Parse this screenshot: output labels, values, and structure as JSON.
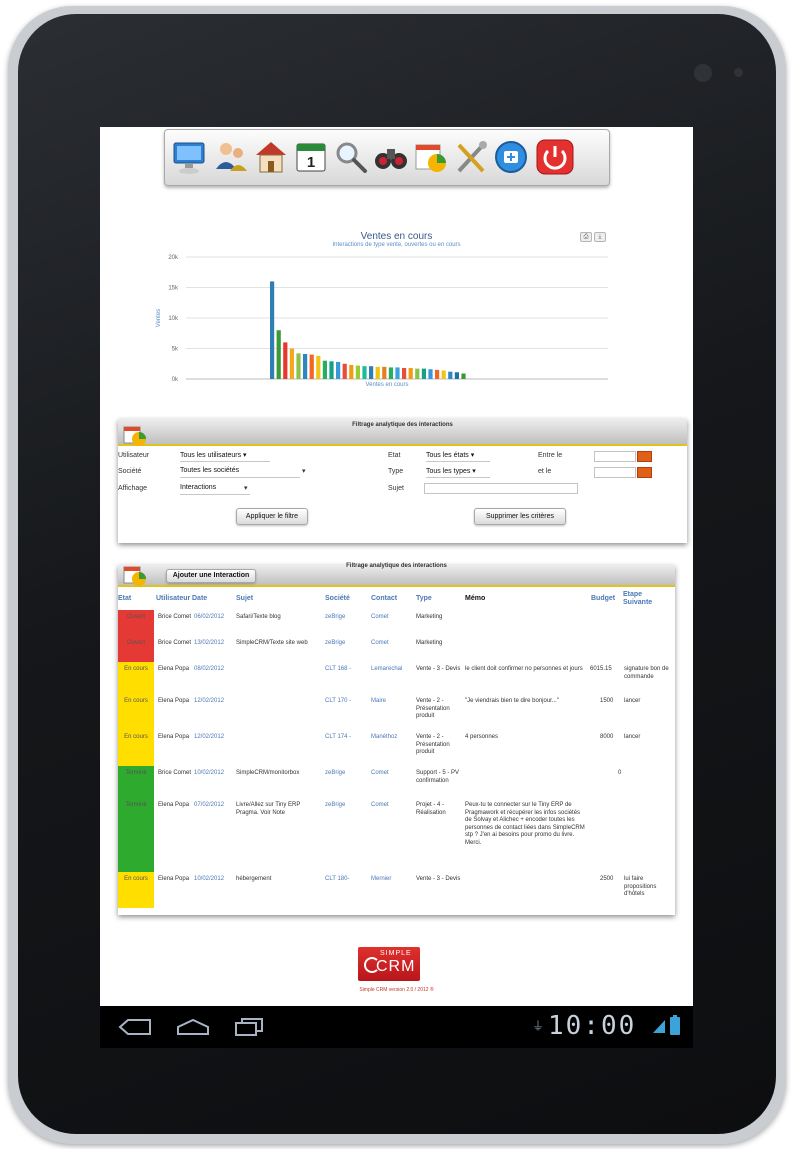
{
  "toolbar": {
    "icons": [
      "computer-icon",
      "users-icon",
      "home-icon",
      "calendar-icon",
      "search-icon",
      "binoculars-icon",
      "reports-icon",
      "tools-icon",
      "add-icon",
      "power-icon"
    ],
    "calendar_day": "1"
  },
  "chart_data": {
    "type": "bar",
    "title": "Ventes en cours",
    "subtitle": "Interactions de type vente, ouvertes ou en cours",
    "ylabel": "Ventes",
    "xlabel": "Ventes en cours",
    "y_ticks": [
      "20k",
      "15k",
      "10k",
      "5k",
      "0k"
    ],
    "ylim": [
      0,
      20000
    ],
    "values": [
      16000,
      8000,
      6000,
      5000,
      4200,
      4100,
      4000,
      3800,
      3000,
      2900,
      2800,
      2500,
      2300,
      2200,
      2100,
      2100,
      2000,
      2000,
      1900,
      1900,
      1800,
      1800,
      1700,
      1700,
      1600,
      1500,
      1400,
      1200,
      1100,
      900
    ],
    "colors": [
      "#2f7fb5",
      "#3a9a35",
      "#e8372c",
      "#f4a81d",
      "#8bc34a",
      "#2e86c1",
      "#f26522",
      "#f0c419",
      "#27ae60",
      "#16a085",
      "#3498db",
      "#e74c3c",
      "#f39c12",
      "#9acd32",
      "#1abc9c",
      "#2f7fb5",
      "#f1c40f",
      "#e67e22",
      "#27ae60",
      "#3aa3d8",
      "#e74c3c",
      "#f39c12",
      "#8bc34a",
      "#16a085",
      "#3498db",
      "#f26522",
      "#f0c419",
      "#2e86c1",
      "#1f6fa8",
      "#3a9a35"
    ],
    "grid": true,
    "legend": "none"
  },
  "filter": {
    "title": "Filtrage analytique des interactions",
    "utilisateur_label": "Utilisateur",
    "utilisateur_value": "Tous les utilisateurs ▾",
    "societe_label": "Société",
    "societe_value": "Toutes les sociétés",
    "affichage_label": "Affichage",
    "affichage_value": "Interactions",
    "etat_label": "Etat",
    "etat_value": "Tous les états ▾",
    "type_label": "Type",
    "type_value": "Tous les types ▾",
    "sujet_label": "Sujet",
    "entre_label": "Entre le",
    "et_label": "et le",
    "apply_button": "Appliquer le filtre",
    "clear_button": "Supprimer les critères"
  },
  "list": {
    "title": "Filtrage analytique des interactions",
    "add_button": "Ajouter une Interaction",
    "headers": {
      "etat": "Etat",
      "utilisateur": "Utilisateur",
      "date": "Date",
      "sujet": "Sujet",
      "societe": "Société",
      "contact": "Contact",
      "type": "Type",
      "memo": "Mémo",
      "budget": "Budget",
      "etape": "Etape Suivante"
    },
    "rows": [
      {
        "etat": "Ouvert",
        "color": "#e53935",
        "utilisateur": "Brice Comet",
        "date": "06/02/2012",
        "sujet": "Safari/Texte blog",
        "societe": "zeBrige",
        "contact": "Comet",
        "type": "Marketing",
        "memo": "",
        "budget": "",
        "etape": ""
      },
      {
        "etat": "Ouvert",
        "color": "#e53935",
        "utilisateur": "Brice Comet",
        "date": "13/02/2012",
        "sujet": "SimpleCRM/Texte site web",
        "societe": "zeBrige",
        "contact": "Comet",
        "type": "Marketing",
        "memo": "",
        "budget": "",
        "etape": ""
      },
      {
        "etat": "En cours",
        "color": "#ffde00",
        "utilisateur": "Elena Popa",
        "date": "08/02/2012",
        "sujet": "",
        "societe": "CLT 168 -",
        "contact": "Lemarechal",
        "type": "Vente - 3 - Devis",
        "memo": "le client doit confirmer no personnes et jours",
        "budget": "6015.15",
        "etape": "signature bon de commande"
      },
      {
        "etat": "En cours",
        "color": "#ffde00",
        "utilisateur": "Elena Popa",
        "date": "12/02/2012",
        "sujet": "",
        "societe": "CLT 170 -",
        "contact": "Maire",
        "type": "Vente - 2 - Présentation produit",
        "memo": "\"Je viendrais bien te dire bonjour...\"",
        "budget": "1500",
        "etape": "lancer"
      },
      {
        "etat": "En cours",
        "color": "#ffde00",
        "utilisateur": "Elena Popa",
        "date": "12/02/2012",
        "sujet": "",
        "societe": "CLT 174 -",
        "contact": "Manéthoz",
        "type": "Vente - 2 - Présentation produit",
        "memo": "4 personnes",
        "budget": "8000",
        "etape": "lancer"
      },
      {
        "etat": "Terminé",
        "color": "#2eaa2e",
        "utilisateur": "Brice Comet",
        "date": "10/02/2012",
        "sujet": "SimpleCRM/monitorbox",
        "societe": "zeBrige",
        "contact": "Comet",
        "type": "Support - 5 - PV confirmation",
        "memo": "",
        "budget": "0",
        "etape": ""
      },
      {
        "etat": "Terminé",
        "color": "#2eaa2e",
        "utilisateur": "Elena Popa",
        "date": "07/02/2012",
        "sujet": "Livre/Allez sur Tiny ERP Pragma. Voir Note",
        "societe": "zeBrige",
        "contact": "Comet",
        "type": "Projet - 4 - Réalisation",
        "memo": "Peux-tu te connecter sur le Tiny ERP de Pragmawork et récupérer les infos sociétés de Solvay et Alichec + encoder toutes les personnes de contact liées dans SimpleCRM stp ? J'en ai besoins pour promo du livre. Merci.",
        "budget": "",
        "etape": ""
      },
      {
        "etat": "En cours",
        "color": "#ffde00",
        "utilisateur": "Elena Popa",
        "date": "10/02/2012",
        "sujet": "hébergement",
        "societe": "CLT 180-",
        "contact": "Mernier",
        "type": "Vente - 3 - Devis",
        "memo": "",
        "budget": "2500",
        "etape": "lui faire propositions d'hôtels"
      }
    ]
  },
  "footer": {
    "logo_top": "SIMPLE",
    "logo_bottom": "CRM",
    "version": "Simple CRM version 2.0 / 2012 ®"
  },
  "statusbar": {
    "clock": "10:00"
  }
}
